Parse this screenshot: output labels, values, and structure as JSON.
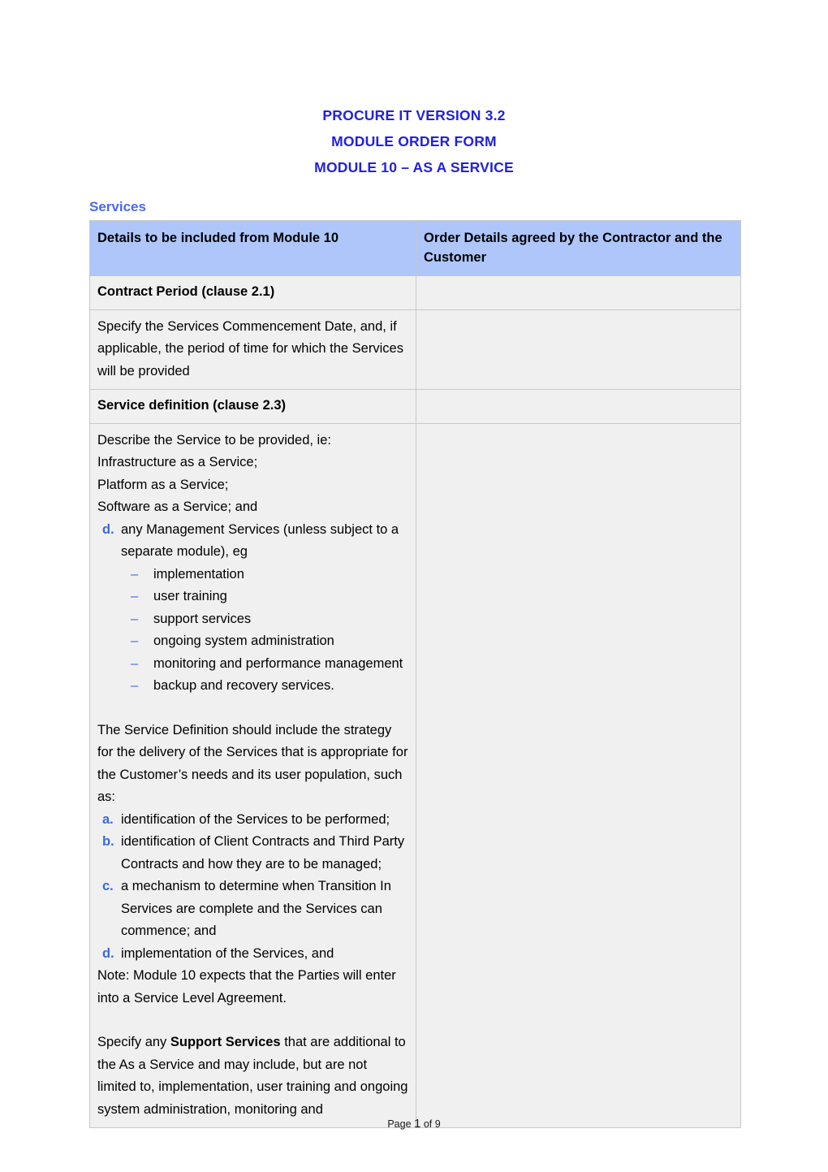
{
  "document": {
    "title_lines": [
      "PROCURE IT VERSION 3.2",
      "MODULE ORDER FORM",
      "MODULE 10 – AS A SERVICE"
    ],
    "section_heading": "Services",
    "title_color": "#2222dd",
    "heading_color": "#4a6ae8",
    "header_row_color": "#aec6fa",
    "cell_color": "#f0f0f0",
    "marker_color": "#3a6ae0"
  },
  "table": {
    "headers": {
      "left": "Details to be included from Module 10",
      "right": "Order Details agreed by the Contractor and the Customer"
    },
    "rows": {
      "contract_period_label": "Contract Period (clause 2.1)",
      "contract_period_body": "Specify the Services Commencement Date, and, if applicable, the period of time for which the Services will be provided",
      "service_definition_label": "Service definition (clause 2.3)",
      "describe_intro": "Describe the Service to be provided, ie:",
      "service_types": [
        "Infrastructure as a Service;",
        "Platform as a Service;",
        "Software as a Service; and"
      ],
      "management_item": {
        "marker": "d.",
        "text": "any Management Services (unless subject to a separate module), eg"
      },
      "management_sub_items": [
        {
          "marker": "–",
          "text": "implementation"
        },
        {
          "marker": "–",
          "text": "user training"
        },
        {
          "marker": "–",
          "text": "support services"
        },
        {
          "marker": "–",
          "text": "ongoing system administration"
        },
        {
          "marker": "–",
          "text": "monitoring and performance management"
        },
        {
          "marker": "–",
          "text": "backup and recovery services."
        }
      ],
      "strategy_para": "The Service Definition should include the strategy for the delivery of the Services that is appropriate for the Customer’s needs and its user population, such as:",
      "strategy_items": [
        {
          "marker": "a.",
          "text": "identification of the Services to be performed;"
        },
        {
          "marker": "b.",
          "text": "identification of Client Contracts and Third Party Contracts and how they are to be managed;"
        },
        {
          "marker": "c.",
          "text": "a mechanism to determine when Transition In Services are complete and the Services can commence; and"
        },
        {
          "marker": "d.",
          "text": "implementation of the Services, and"
        }
      ],
      "note_para": "Note: Module 10 expects that the Parties will enter into a Service Level Agreement.",
      "support_para_prefix": "Specify any ",
      "support_para_bold": "Support Services",
      "support_para_suffix": " that are additional to the As a Service and may include, but are not limited to, implementation, user training and ongoing system administration, monitoring and"
    }
  },
  "footer": {
    "prefix": "Page ",
    "page_number": "1",
    "suffix": " of 9"
  }
}
